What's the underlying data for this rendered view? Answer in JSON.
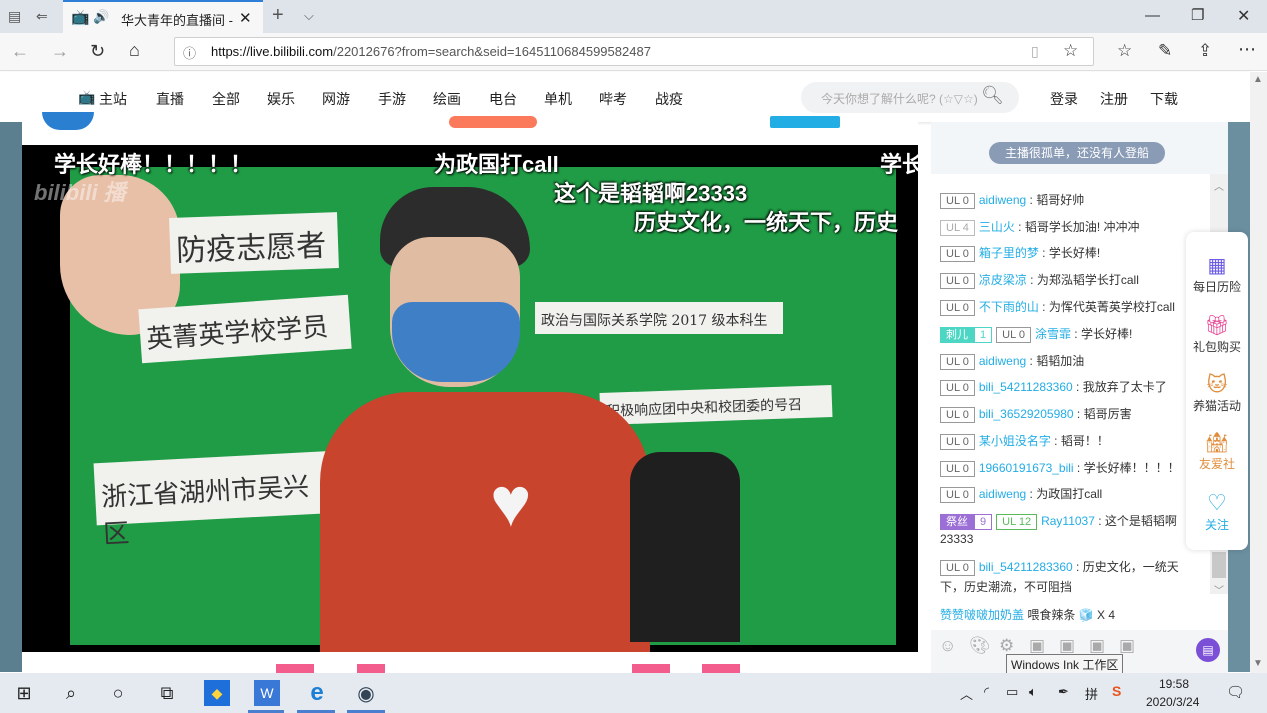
{
  "browser": {
    "tab_title": "华大青年的直播间 -",
    "tab_close": "✕",
    "new_tab": "+",
    "url_host": "https://live.bilibili.com",
    "url_path": "/22012676?from=search&seid=1645110684599582487"
  },
  "site_nav": {
    "home": "主站",
    "items": [
      "直播",
      "全部",
      "娱乐",
      "网游",
      "手游",
      "绘画",
      "电台",
      "单机",
      "哔考",
      "战疫"
    ],
    "search_placeholder": "今天你想了解什么呢? (☆▽☆)",
    "login": "登录",
    "register": "注册",
    "download": "下载"
  },
  "player": {
    "watermark": "bilibili 播",
    "danmaku": [
      "学长好棒！！！！！",
      "为政国打call",
      "学长",
      "这个是韬韬啊23333",
      "历史文化，一统天下，历史"
    ],
    "papers": {
      "p1": "防疫志愿者",
      "p2": "英菁英学校学员",
      "p3": "政治与国际关系学院 2017 级本科生",
      "p4": "积极响应团中央和校团委的号召",
      "p5": "浙江省湖州市吴兴区"
    }
  },
  "chat": {
    "top_banner": "主播很孤单，还没有人登船",
    "messages": [
      {
        "badge": "UL 0",
        "user": "aidiweng",
        "text": "韬哥好帅"
      },
      {
        "badge": "UL 4",
        "user": "三山火",
        "text": "韬哥学长加油! 冲冲冲"
      },
      {
        "badge": "UL 0",
        "user": "箱子里的梦",
        "text": "学长好棒!"
      },
      {
        "badge": "UL 0",
        "user": "凉皮梁凉",
        "text": "为郑泓韬学长打call"
      },
      {
        "badge": "UL 0",
        "user": "不下雨的山",
        "text": "为恽代英菁英学校打call"
      },
      {
        "medal": "刺儿",
        "medal_level": "1",
        "badge": "UL 0",
        "user": "涂雪霏",
        "text": "学长好棒!"
      },
      {
        "badge": "UL 0",
        "user": "aidiweng",
        "text": "韬韬加油"
      },
      {
        "badge": "UL 0",
        "user": "bili_54211283360",
        "text": "我放弃了太卡了"
      },
      {
        "badge": "UL 0",
        "user": "bili_36529205980",
        "text": "韬哥厉害"
      },
      {
        "badge": "UL 0",
        "user": "某小姐没名字",
        "text": "韬哥！！"
      },
      {
        "badge": "UL 0",
        "user": "19660191673_bili",
        "text": "学长好棒！！！！"
      },
      {
        "badge": "UL 0",
        "user": "aidiweng",
        "text": "为政国打call"
      },
      {
        "medal": "祭丝",
        "medal_level": "9",
        "badge": "UL 12",
        "user": "Ray11037",
        "text": "这个是韬韬啊",
        "cont": "23333"
      },
      {
        "badge": "UL 0",
        "user": "bili_54211283360",
        "text": "历史文化，一统天",
        "cont": "下，历史潮流，不可阻挡"
      }
    ],
    "gift_user": "赞赞啵啵加奶盖",
    "gift_action": "喂食辣条",
    "gift_count": "X 4",
    "tooltip": "Windows Ink 工作区"
  },
  "float_panel": [
    "每日历险",
    "礼包购买",
    "养猫活动",
    "友爱社",
    "关注"
  ],
  "taskbar": {
    "time": "19:58",
    "date": "2020/3/24"
  },
  "colors": {
    "accent": "#23ade5",
    "pink": "#f25d8e",
    "green": "#1f9c45"
  }
}
